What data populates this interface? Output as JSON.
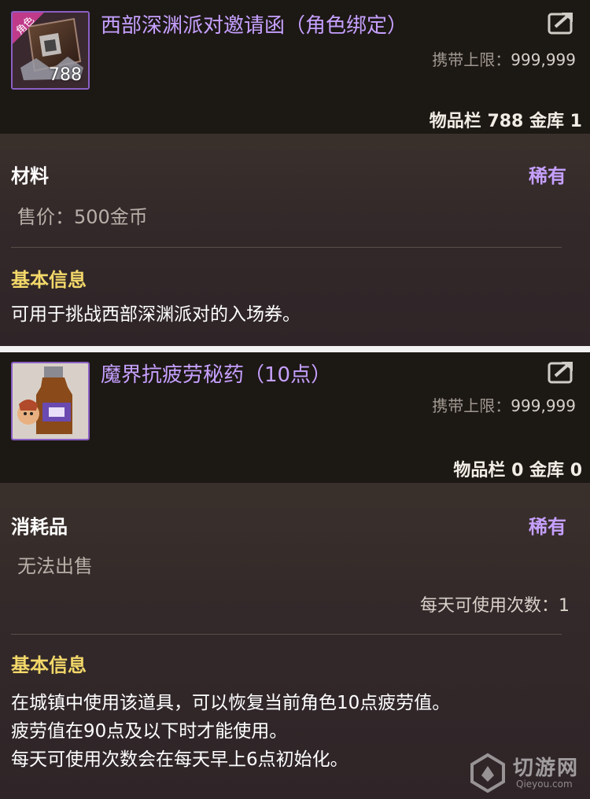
{
  "items": [
    {
      "title": "西部深渊派对邀请函（角色绑定）",
      "icon": "invitation-ticket-icon",
      "badge": "角色",
      "count": "788",
      "carry_label": "携带上限：",
      "carry_value": "999,999",
      "stock": "物品栏 788 金库 1",
      "category": "材料",
      "rarity": "稀有",
      "sell": "售价：500金币",
      "section": "基本信息",
      "desc": [
        "可用于挑战西部深渊派对的入场券。"
      ]
    },
    {
      "title": "魔界抗疲劳秘药（10点）",
      "icon": "potion-bottle-icon",
      "carry_label": "携带上限：",
      "carry_value": "999,999",
      "stock": "物品栏 0 金库 0",
      "category": "消耗品",
      "rarity": "稀有",
      "sell": "无法出售",
      "daily": "每天可使用次数：1",
      "section": "基本信息",
      "desc": [
        "在城镇中使用该道具，可以恢复当前角色10点疲劳值。",
        "疲劳值在90点及以下时才能使用。",
        "每天可使用次数会在每天早上6点初始化。"
      ]
    }
  ],
  "watermark": {
    "main": "切游网",
    "sub": "Qieyou.com"
  },
  "colors": {
    "title": "#c6a0ff",
    "section": "#f3d86a",
    "rarity": "#c6a0ff"
  }
}
